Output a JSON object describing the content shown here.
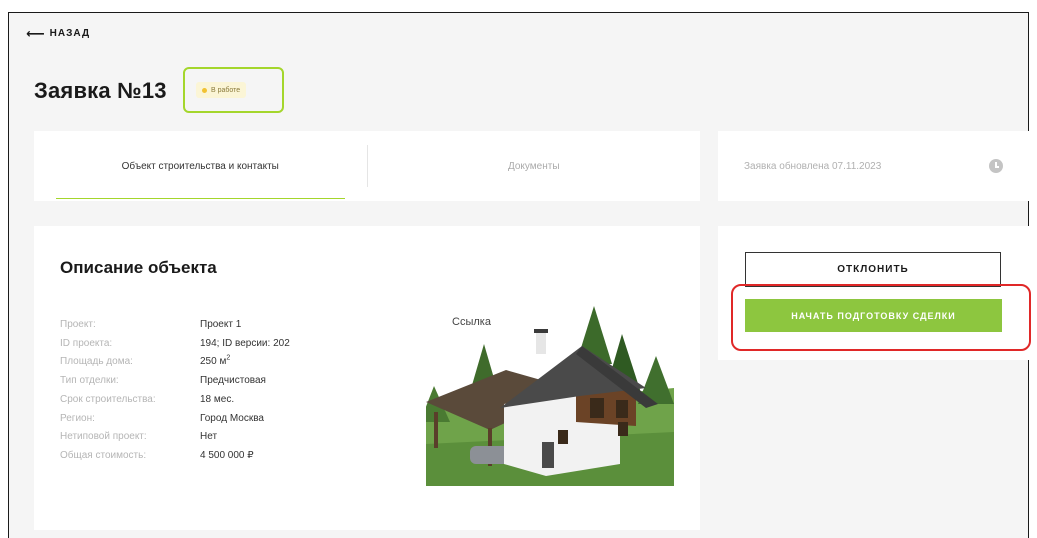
{
  "nav": {
    "back_arrow": "⟵",
    "back_label": "НАЗАД"
  },
  "header": {
    "title": "Заявка №13",
    "status": "В работе"
  },
  "colors": {
    "accent": "#8dc63f",
    "highlight_green": "#a4d62c",
    "highlight_red": "#e02828",
    "status_dot": "#f1c232"
  },
  "tabs": [
    {
      "label": "Объект строительства и контакты",
      "active": true
    },
    {
      "label": "Документы",
      "active": false
    }
  ],
  "updated": {
    "text": "Заявка обновлена 07.11.2023",
    "icon": "clock-icon"
  },
  "object": {
    "title": "Описание объекта",
    "photo_link": "Ссылка",
    "properties": [
      {
        "label": "Проект:",
        "value": "Проект 1"
      },
      {
        "label": "ID проекта:",
        "value": "194; ID версии: 202"
      },
      {
        "label": "Площадь дома:",
        "value": "250 м",
        "sup": "2"
      },
      {
        "label": "Тип отделки:",
        "value": "Предчистовая"
      },
      {
        "label": "Срок строительства:",
        "value": "18 мес."
      },
      {
        "label": "Регион:",
        "value": "Город Москва"
      },
      {
        "label": "Нетиповой проект:",
        "value": "Нет"
      },
      {
        "label": "Общая стоимость:",
        "value": "4 500 000 ₽"
      }
    ]
  },
  "actions": {
    "reject_label": "ОТКЛОНИТЬ",
    "start_label": "НАЧАТЬ ПОДГОТОВКУ СДЕЛКИ"
  }
}
